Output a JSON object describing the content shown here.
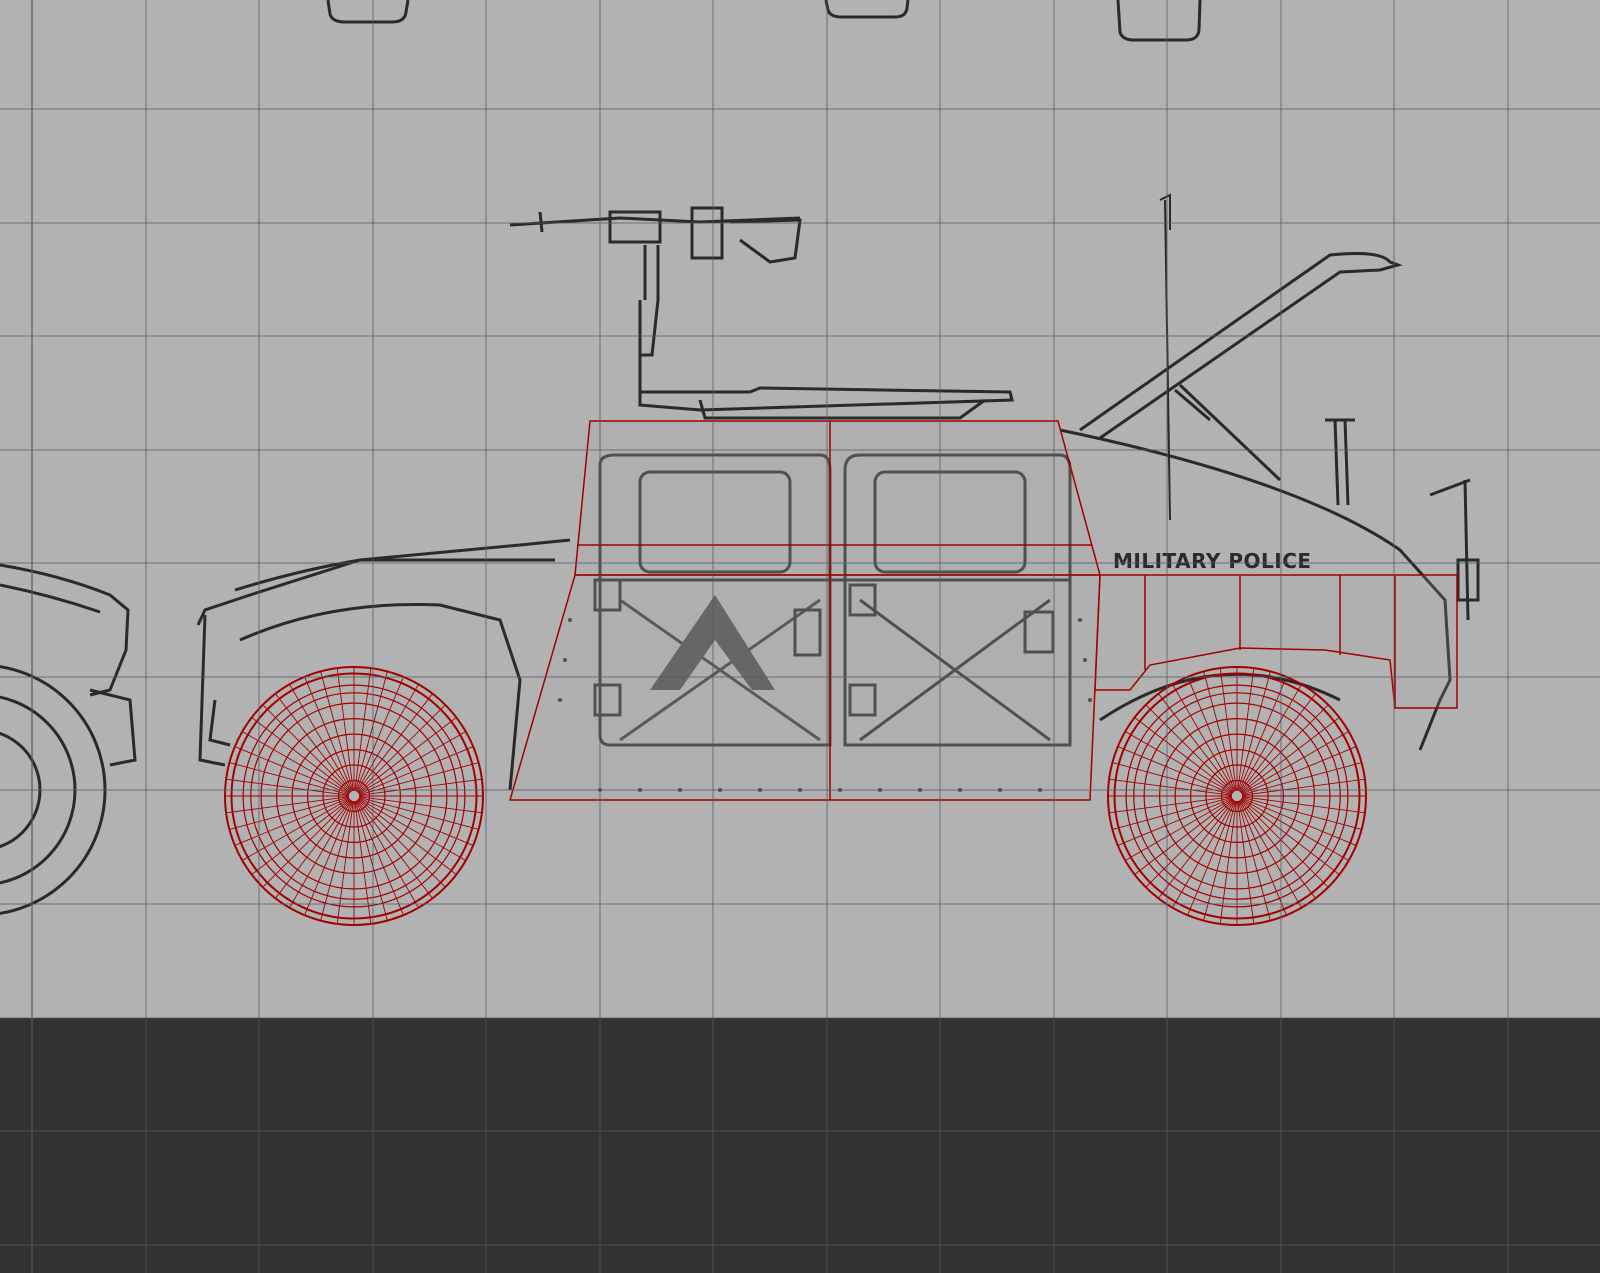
{
  "viewport": {
    "background_color": "#323232",
    "blueprint_color": "#b2b2b2",
    "grid_color": "#505a6a",
    "line_color": "#2a2a2a",
    "mesh_color": "#a30000"
  },
  "blueprint": {
    "vehicle_label": "MILITARY POLICE"
  }
}
